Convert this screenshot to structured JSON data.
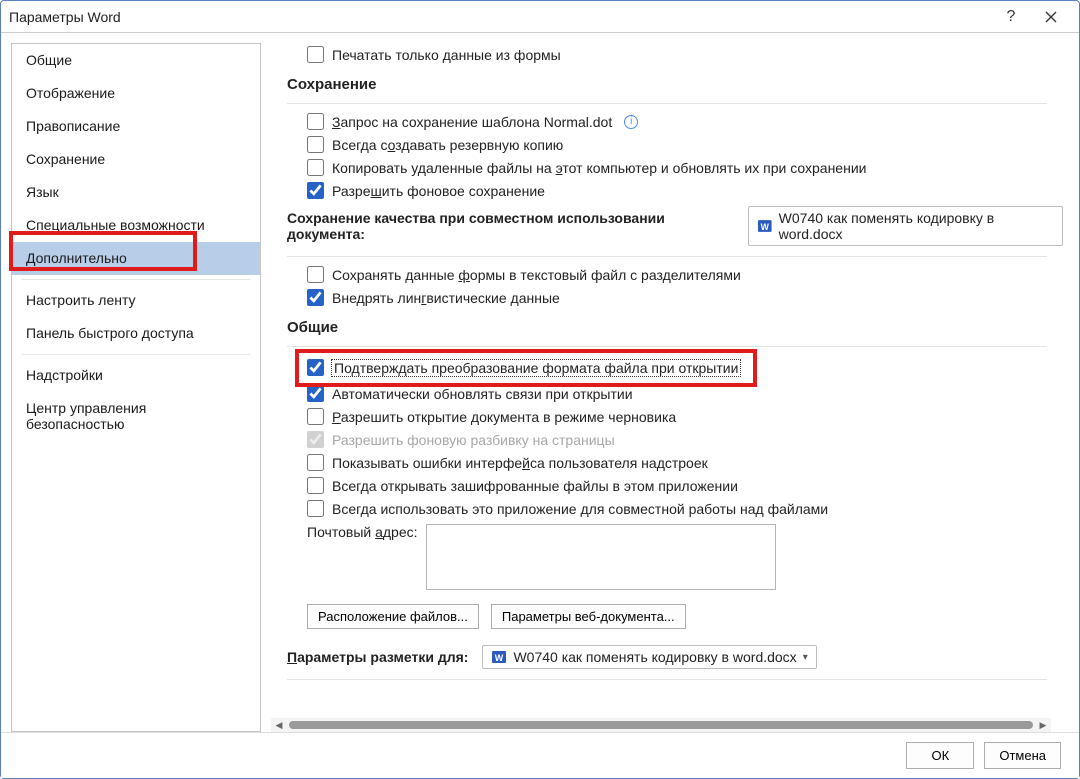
{
  "titlebar": {
    "title": "Параметры Word"
  },
  "sidebar": {
    "items": [
      {
        "label": "Общие"
      },
      {
        "label": "Отображение"
      },
      {
        "label": "Правописание"
      },
      {
        "label": "Сохранение"
      },
      {
        "label": "Язык"
      },
      {
        "label": "Специальные возможности"
      },
      {
        "label": "Дополнительно",
        "active": true
      },
      {
        "label": "Настроить ленту"
      },
      {
        "label": "Панель быстрого доступа"
      },
      {
        "label": "Надстройки"
      },
      {
        "label": "Центр управления безопасностью"
      }
    ]
  },
  "top": {
    "print_form_only": "Печатать только данные из формы"
  },
  "save_section": {
    "head": "Сохранение",
    "normal_dot": "Запрос на сохранение шаблона Normal.dot",
    "backup": "Всегда создавать резервную копию",
    "copy_remote": "Копировать удаленные файлы на этот компьютер и обновлять их при сохранении",
    "background_save": "Разрешить фоновое сохранение"
  },
  "share_section": {
    "head": "Сохранение качества при совместном использовании документа:",
    "doc_name": "W0740 как поменять кодировку в word.docx",
    "form_data": "Сохранять данные формы в текстовый файл с разделителями",
    "linguistic": "Внедрять лингвистические данные"
  },
  "general_section": {
    "head": "Общие",
    "confirm_conv": "Подтверждать преобразование формата файла при открытии",
    "auto_links": "Автоматически обновлять связи при открытии",
    "draft": "Разрешить открытие документа в режиме черновика",
    "bg_repag": "Разрешить фоновую разбивку на страницы",
    "addin_errors": "Показывать ошибки интерфейса пользователя надстроек",
    "encrypted": "Всегда открывать зашифрованные файлы в этом приложении",
    "collab": "Всегда использовать это приложение для совместной работы над файлами",
    "mail_label": "Почтовый адрес:",
    "file_locations": "Расположение файлов...",
    "web_options": "Параметры веб-документа..."
  },
  "layout_section": {
    "head": "Параметры разметки для:",
    "doc_name": "W0740 как поменять кодировку в word.docx"
  },
  "footer": {
    "ok": "ОК",
    "cancel": "Отмена"
  }
}
